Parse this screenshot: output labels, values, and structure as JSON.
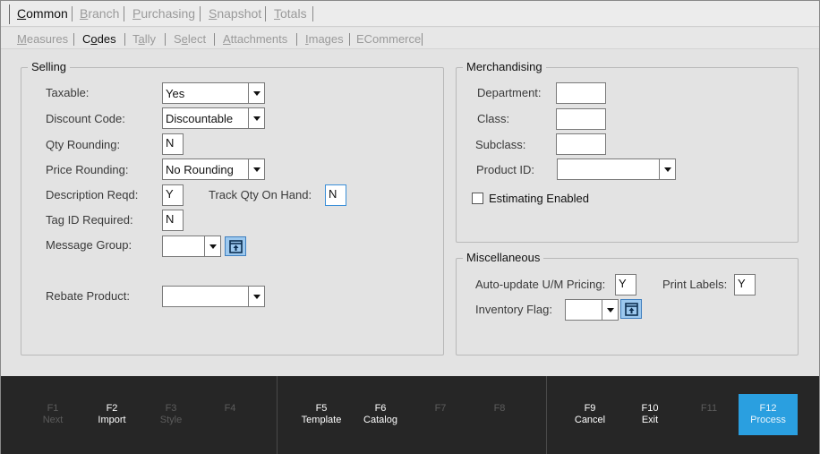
{
  "tabs_main": [
    "Common",
    "Branch",
    "Purchasing",
    "Snapshot",
    "Totals"
  ],
  "tabs_sub": [
    "Measures",
    "Codes",
    "Tally",
    "Select",
    "Attachments",
    "Images",
    "ECommerce"
  ],
  "selling": {
    "title": "Selling",
    "taxable_label": "Taxable:",
    "taxable_value": "Yes",
    "discount_label": "Discount Code:",
    "discount_value": "Discountable",
    "qty_rounding_label": "Qty Rounding:",
    "qty_rounding_value": "N",
    "price_rounding_label": "Price Rounding:",
    "price_rounding_value": "No Rounding",
    "desc_reqd_label": "Description Reqd:",
    "desc_reqd_value": "Y",
    "track_qty_label": "Track Qty On Hand:",
    "track_qty_value": "N",
    "tag_id_label": "Tag ID Required:",
    "tag_id_value": "N",
    "message_group_label": "Message Group:",
    "message_group_value": "",
    "rebate_label": "Rebate Product:",
    "rebate_value": ""
  },
  "merch": {
    "title": "Merchandising",
    "department_label": "Department:",
    "department_value": "",
    "class_label": "Class:",
    "class_value": "",
    "subclass_label": "Subclass:",
    "subclass_value": "",
    "product_id_label": "Product ID:",
    "product_id_value": "",
    "estimating_label": "Estimating Enabled"
  },
  "misc": {
    "title": "Miscellaneous",
    "auto_update_label": "Auto-update U/M Pricing:",
    "auto_update_value": "Y",
    "print_labels_label": "Print Labels:",
    "print_labels_value": "Y",
    "inventory_flag_label": "Inventory Flag:",
    "inventory_flag_value": ""
  },
  "fkeys": [
    {
      "key": "F1",
      "name": "Next"
    },
    {
      "key": "F2",
      "name": "Import"
    },
    {
      "key": "F3",
      "name": "Style"
    },
    {
      "key": "F4",
      "name": ""
    },
    {
      "key": "F5",
      "name": "Template"
    },
    {
      "key": "F6",
      "name": "Catalog"
    },
    {
      "key": "F7",
      "name": ""
    },
    {
      "key": "F8",
      "name": ""
    },
    {
      "key": "F9",
      "name": "Cancel"
    },
    {
      "key": "F10",
      "name": "Exit"
    },
    {
      "key": "F11",
      "name": ""
    },
    {
      "key": "F12",
      "name": "Process"
    }
  ],
  "colors": {
    "accent": "#2a9fe0",
    "fbar_bg": "#262626",
    "lookup_button": "#9cc8ee"
  },
  "icons": {
    "lookup": "lookup-icon",
    "dropdown": "chevron-down-icon"
  }
}
